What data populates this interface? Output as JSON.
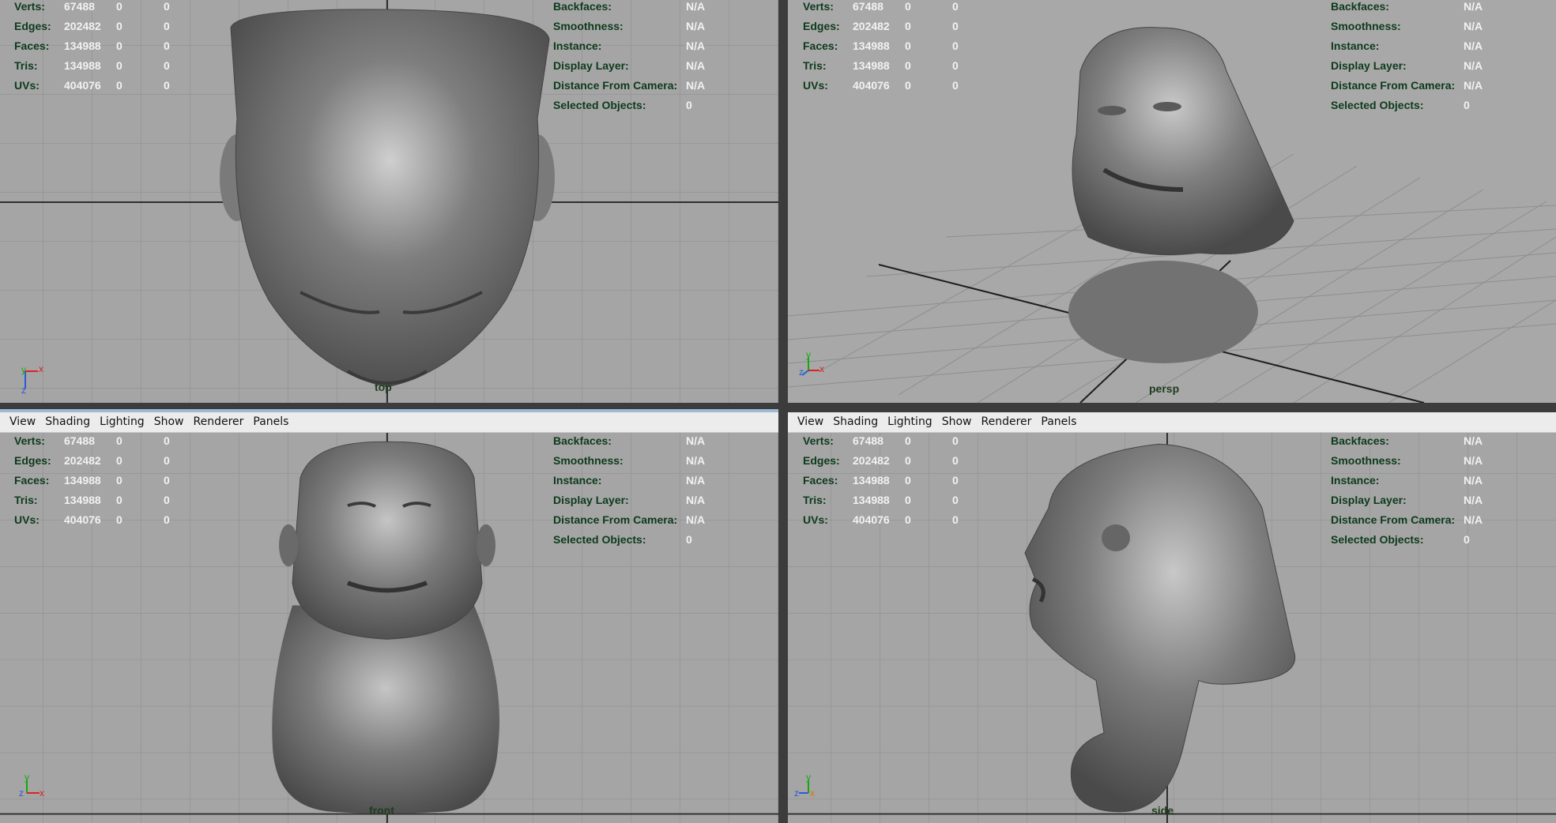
{
  "menu": [
    "View",
    "Shading",
    "Lighting",
    "Show",
    "Renderer",
    "Panels"
  ],
  "hud_left": [
    {
      "label": "Verts:",
      "v1": "67488",
      "v2": "0",
      "v3": "0"
    },
    {
      "label": "Edges:",
      "v1": "202482",
      "v2": "0",
      "v3": "0"
    },
    {
      "label": "Faces:",
      "v1": "134988",
      "v2": "0",
      "v3": "0"
    },
    {
      "label": "Tris:",
      "v1": "134988",
      "v2": "0",
      "v3": "0"
    },
    {
      "label": "UVs:",
      "v1": "404076",
      "v2": "0",
      "v3": "0"
    }
  ],
  "hud_right": [
    {
      "label": "Backfaces:",
      "value": "N/A"
    },
    {
      "label": "Smoothness:",
      "value": "N/A"
    },
    {
      "label": "Instance:",
      "value": "N/A"
    },
    {
      "label": "Display Layer:",
      "value": "N/A"
    },
    {
      "label": "Distance From Camera:",
      "value": "N/A"
    },
    {
      "label": "Selected Objects:",
      "value": "0"
    }
  ],
  "viewports": {
    "top": {
      "camera": "top"
    },
    "persp": {
      "camera": "persp"
    },
    "front": {
      "camera": "front"
    },
    "side": {
      "camera": "side"
    }
  },
  "colors": {
    "viewport_bg": "#a5a5a5",
    "grid": "#8e8e8e",
    "hud_label": "#0d3a1c",
    "hud_value": "#f2f2f2",
    "menubar": "#ececec"
  }
}
